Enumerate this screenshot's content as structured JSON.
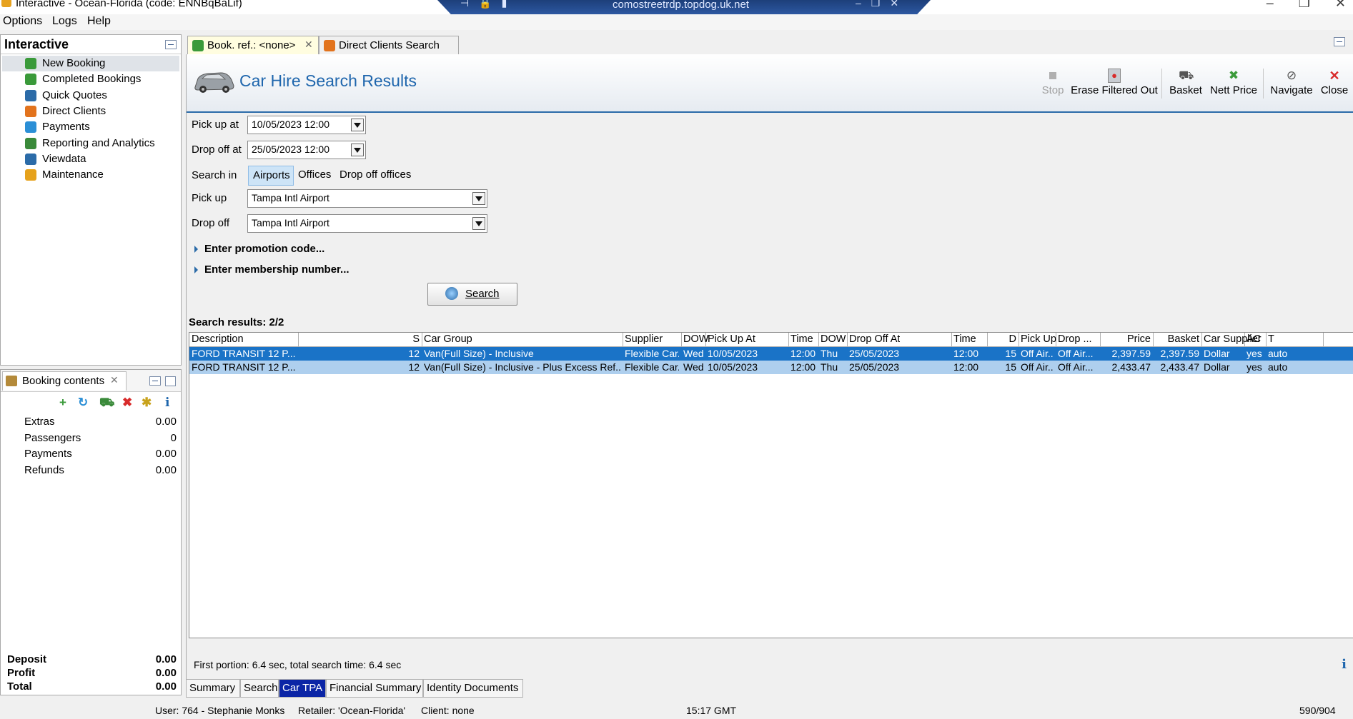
{
  "window": {
    "title": "Interactive - Ocean-Florida (code: ENNBqBaLif)",
    "rdp_host": "comostreetrdp.topdog.uk.net"
  },
  "menu": [
    "Options",
    "Logs",
    "Help"
  ],
  "nav": {
    "title": "Interactive",
    "items": [
      {
        "label": "New Booking",
        "icon": "palm-tree-icon",
        "color": "#3a9a3a"
      },
      {
        "label": "Completed Bookings",
        "icon": "palm-tree-icon",
        "color": "#3a9a3a"
      },
      {
        "label": "Quick Quotes",
        "icon": "clock-icon",
        "color": "#2b6ba8"
      },
      {
        "label": "Direct Clients",
        "icon": "person-icon",
        "color": "#e2731d"
      },
      {
        "label": "Payments",
        "icon": "payments-icon",
        "color": "#2b8fd6"
      },
      {
        "label": "Reporting and Analytics",
        "icon": "report-icon",
        "color": "#3a8a3a"
      },
      {
        "label": "Viewdata",
        "icon": "globe-icon",
        "color": "#2b6ba8"
      },
      {
        "label": "Maintenance",
        "icon": "maintenance-icon",
        "color": "#e6a21c"
      }
    ]
  },
  "booking_contents": {
    "tab_label": "Booking contents",
    "rows": [
      {
        "label": "Extras",
        "value": "0.00"
      },
      {
        "label": "Passengers",
        "value": "0"
      },
      {
        "label": "Payments",
        "value": "0.00"
      },
      {
        "label": "Refunds",
        "value": "0.00"
      }
    ],
    "totals": [
      {
        "label": "Deposit",
        "value": "0.00"
      },
      {
        "label": "Profit",
        "value": "0.00"
      },
      {
        "label": "Total",
        "value": "0.00"
      }
    ],
    "info_glyph": "i"
  },
  "main_tabs": [
    {
      "label": "Book. ref.: <none>"
    },
    {
      "label": "Direct Clients Search"
    }
  ],
  "header": {
    "title": "Car Hire Search Results",
    "toolbar": {
      "stop": "Stop",
      "erase": "Erase Filtered Out",
      "basket": "Basket",
      "nett_price": "Nett Price",
      "navigate": "Navigate",
      "close": "Close"
    }
  },
  "form": {
    "pickup_at_label": "Pick up at",
    "pickup_at_value": "10/05/2023 12:00",
    "dropoff_at_label": "Drop off at",
    "dropoff_at_value": "25/05/2023 12:00",
    "search_in_label": "Search in",
    "search_in_options": [
      "Airports",
      "Offices",
      "Drop off offices"
    ],
    "search_in_selected": "Airports",
    "pickup_label": "Pick up",
    "pickup_value": "Tampa Intl Airport",
    "dropoff_label": "Drop off",
    "dropoff_value": "Tampa Intl Airport",
    "promo": "Enter promotion code...",
    "membership": "Enter membership number...",
    "search_button": "Search"
  },
  "results": {
    "label": "Search results: 2/2",
    "columns": [
      "Description",
      "S",
      "Car Group",
      "Supplier",
      "DOW",
      "Pick Up At",
      "Time",
      "DOW",
      "Drop Off At",
      "Time",
      "D",
      "Pick Up",
      "Drop ...",
      "Price",
      "Basket",
      "Car Supplier",
      "AC",
      "T"
    ],
    "rows": [
      [
        "FORD TRANSIT 12 P...",
        "12",
        "Van(Full Size) - Inclusive",
        "Flexible Car...",
        "Wed",
        "10/05/2023",
        "12:00",
        "Thu",
        "25/05/2023",
        "12:00",
        "15",
        "Off Air...",
        "Off Air...",
        "2,397.59",
        "2,397.59",
        "Dollar",
        "yes",
        "auto"
      ],
      [
        "FORD TRANSIT 12 P...",
        "12",
        "Van(Full Size) - Inclusive - Plus Excess Ref...",
        "Flexible Car...",
        "Wed",
        "10/05/2023",
        "12:00",
        "Thu",
        "25/05/2023",
        "12:00",
        "15",
        "Off Air...",
        "Off Air...",
        "2,433.47",
        "2,433.47",
        "Dollar",
        "yes",
        "auto"
      ]
    ]
  },
  "timing": "First portion: 6.4 sec, total search time: 6.4 sec",
  "info_glyph": "i",
  "bottom_tabs": [
    {
      "label": "Summary"
    },
    {
      "label": "Search"
    },
    {
      "label": "Car TPA"
    },
    {
      "label": "Financial Summary"
    },
    {
      "label": "Identity Documents"
    }
  ],
  "selected_bottom_tab": "Car TPA",
  "status": {
    "user": "User: 764 - Stephanie Monks",
    "retailer": "Retailer: 'Ocean-Florida'",
    "client": "Client: none",
    "time": "15:17 GMT",
    "memory": "590/904"
  }
}
